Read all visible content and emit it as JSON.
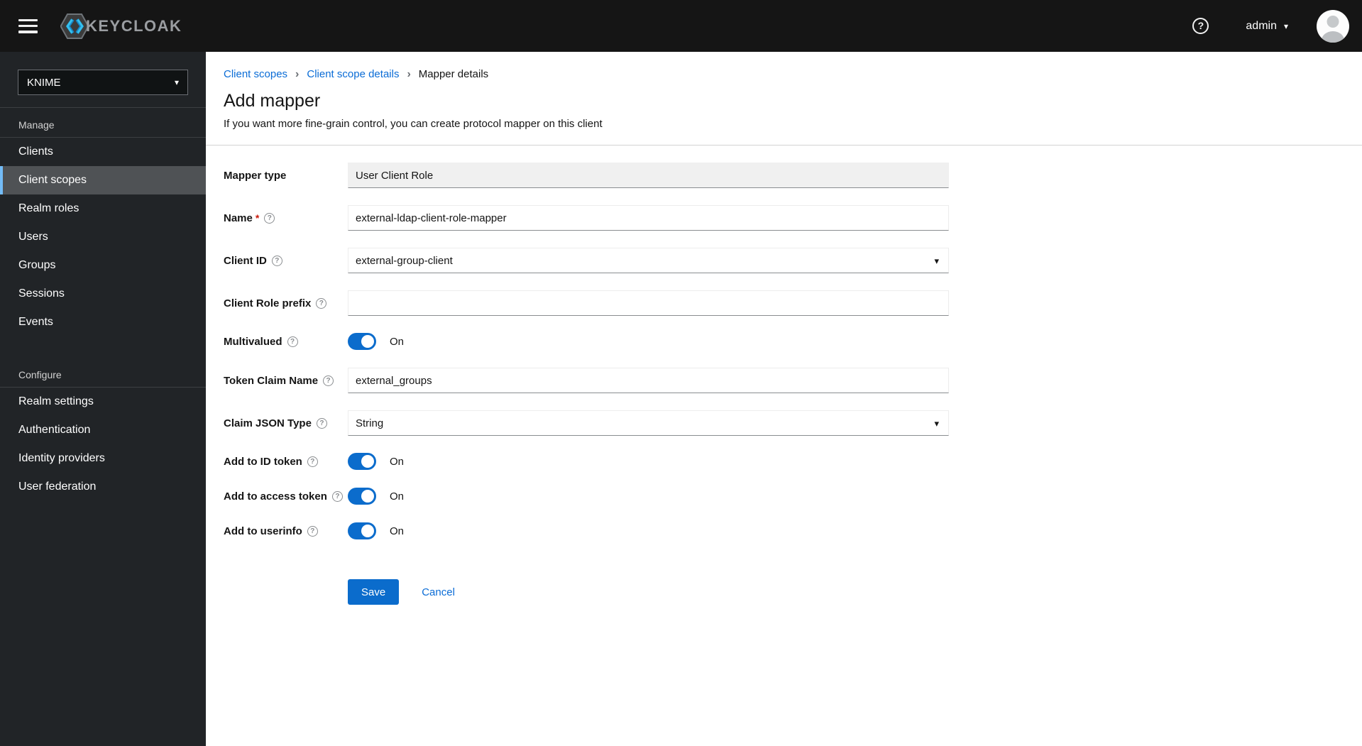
{
  "masthead": {
    "brand_text": "KEYCLOAK",
    "user_name": "admin",
    "icons": {
      "menu": "menu-icon",
      "help": "question-circle-icon",
      "user_caret": "chevron-down-icon",
      "avatar": "avatar"
    }
  },
  "sidebar": {
    "realm_selector": {
      "value": "KNIME"
    },
    "sections": [
      {
        "label": "Manage",
        "items": [
          {
            "label": "Clients",
            "current": false
          },
          {
            "label": "Client scopes",
            "current": true
          },
          {
            "label": "Realm roles",
            "current": false
          },
          {
            "label": "Users",
            "current": false
          },
          {
            "label": "Groups",
            "current": false
          },
          {
            "label": "Sessions",
            "current": false
          },
          {
            "label": "Events",
            "current": false
          }
        ]
      },
      {
        "label": "Configure",
        "items": [
          {
            "label": "Realm settings",
            "current": false
          },
          {
            "label": "Authentication",
            "current": false
          },
          {
            "label": "Identity providers",
            "current": false
          },
          {
            "label": "User federation",
            "current": false
          }
        ]
      }
    ]
  },
  "breadcrumb": {
    "items": [
      {
        "label": "Client scopes",
        "link": true
      },
      {
        "label": "Client scope details",
        "link": true
      },
      {
        "label": "Mapper details",
        "link": false
      }
    ]
  },
  "page": {
    "title": "Add mapper",
    "subtitle": "If you want more fine-grain control, you can create protocol mapper on this client"
  },
  "form": {
    "required_marker": "*",
    "fields": [
      {
        "label": "Mapper type",
        "type": "readonly",
        "value": "User Client Role"
      },
      {
        "label": "Name",
        "type": "text",
        "required": true,
        "help": true,
        "value": "external-ldap-client-role-mapper"
      },
      {
        "label": "Client ID",
        "type": "select",
        "help": true,
        "value": "external-group-client"
      },
      {
        "label": "Client Role prefix",
        "type": "text",
        "help": true,
        "value": ""
      },
      {
        "label": "Multivalued",
        "type": "toggle",
        "help": true,
        "state": true,
        "state_label": "On"
      },
      {
        "label": "Token Claim Name",
        "type": "text",
        "help": true,
        "value": "external_groups"
      },
      {
        "label": "Claim JSON Type",
        "type": "select",
        "help": true,
        "value": "String"
      },
      {
        "label": "Add to ID token",
        "type": "toggle",
        "help": true,
        "state": true,
        "state_label": "On"
      },
      {
        "label": "Add to access token",
        "type": "toggle",
        "help": true,
        "state": true,
        "state_label": "On"
      },
      {
        "label": "Add to userinfo",
        "type": "toggle",
        "help": true,
        "state": true,
        "state_label": "On"
      }
    ],
    "actions": {
      "save": "Save",
      "cancel": "Cancel"
    }
  },
  "colors": {
    "accent": "#0b6ccc",
    "masthead_bg": "#151515",
    "sidebar_bg": "#212427",
    "current_nav_indicator": "#73bcf7",
    "required": "#c9190b"
  }
}
